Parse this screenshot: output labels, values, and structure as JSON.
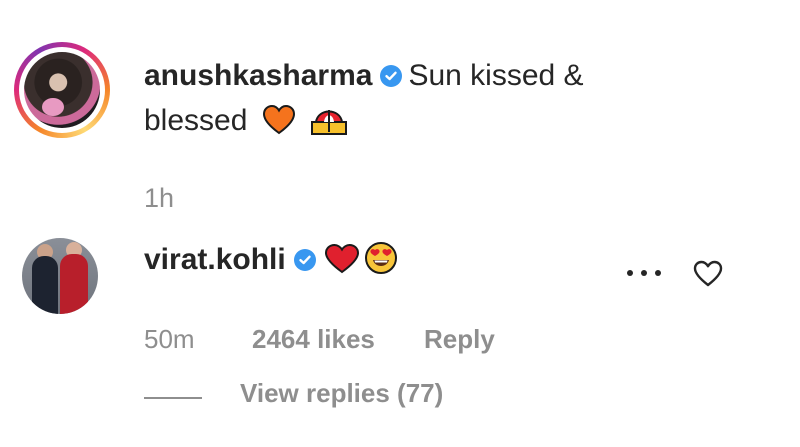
{
  "post": {
    "username": "anushkasharma",
    "caption_part1": "Sun kissed &",
    "caption_part2": "blessed",
    "time": "1h"
  },
  "comment": {
    "username": "virat.kohli",
    "time": "50m",
    "likes": "2464 likes",
    "reply_label": "Reply",
    "view_replies": "View replies (77)"
  },
  "icons": {
    "verified": "verified-badge-icon",
    "more": "more-options-icon",
    "like": "heart-outline-icon"
  },
  "colors": {
    "verified_blue": "#3897f0",
    "secondary_text": "#8e8e8e",
    "primary_text": "#262626"
  }
}
